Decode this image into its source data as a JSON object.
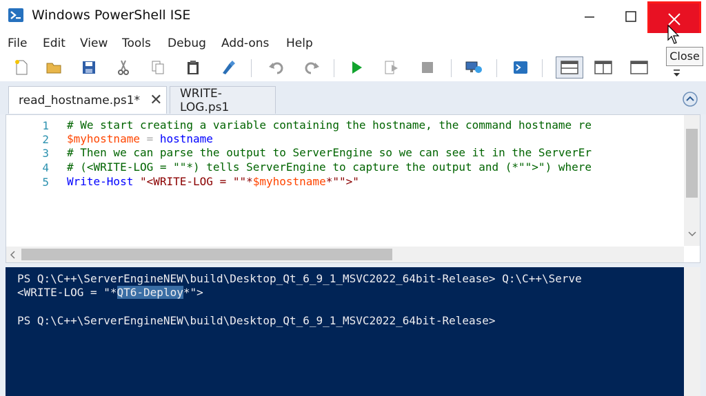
{
  "window": {
    "title": "Windows PowerShell ISE",
    "close_tooltip": "Close"
  },
  "menu": [
    "File",
    "Edit",
    "View",
    "Tools",
    "Debug",
    "Add-ons",
    "Help"
  ],
  "toolbar": [
    "new-icon",
    "open-icon",
    "save-icon",
    "cut-icon",
    "copy-icon",
    "paste-icon",
    "clear-console-icon",
    "undo-icon",
    "redo-icon",
    "run-icon",
    "run-selection-icon",
    "stop-icon",
    "new-remote-tab-icon",
    "powershell-icon",
    "layout-top-icon",
    "layout-right-icon",
    "layout-max-icon"
  ],
  "tabs": [
    {
      "label": "read_hostname.ps1*",
      "active": true
    },
    {
      "label": "WRITE-LOG.ps1",
      "active": false
    }
  ],
  "editor": {
    "line_numbers": [
      "1",
      "2",
      "3",
      "4",
      "5"
    ],
    "lines": [
      "# We start creating a variable containing the hostname, the command hostname re",
      "$myhostname = hostname",
      "# Then we can parse the output to ServerEngine so we can see it in the ServerEr",
      "# (<WRITE-LOG = \"\"*) tells ServerEngine to capture the output and (*\"\">\") where",
      "Write-Host \"<WRITE-LOG = \"\"*$myhostname*\"\">\""
    ],
    "line2": {
      "var": "$myhostname",
      "op": " = ",
      "cmd": "hostname"
    },
    "line5": {
      "cmd": "Write-Host",
      "space": " ",
      "str_a": "\"<WRITE-LOG = \"\"*",
      "var": "$myhostname",
      "str_b": "*\"\">\""
    }
  },
  "console": {
    "line1": "PS Q:\\C++\\ServerEngineNEW\\build\\Desktop_Qt_6_9_1_MSVC2022_64bit-Release> Q:\\C++\\Serve",
    "line2_pre": "<WRITE-LOG = \"*",
    "line2_sel": "QT6-Deploy",
    "line2_post": "*\">",
    "line4": "PS Q:\\C++\\ServerEngineNEW\\build\\Desktop_Qt_6_9_1_MSVC2022_64bit-Release>"
  },
  "colors": {
    "console_bg": "#012456",
    "close_red": "#e81123",
    "comment": "#006400",
    "variable": "#ff4500",
    "command": "#0000ff"
  }
}
